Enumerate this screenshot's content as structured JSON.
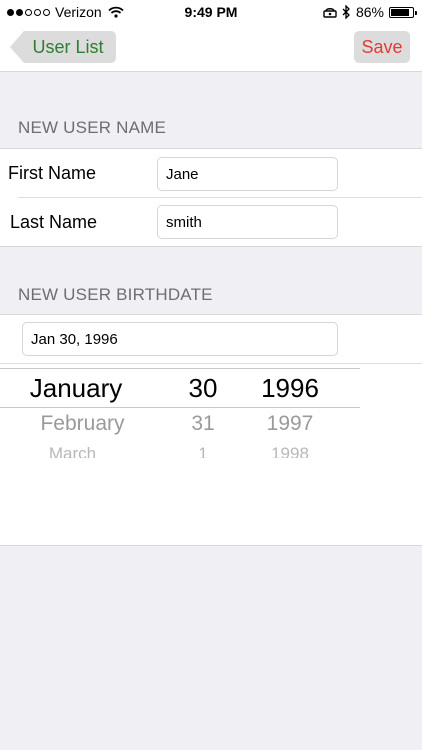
{
  "status_bar": {
    "carrier": "Verizon",
    "time": "9:49 PM",
    "battery_percent_label": "86%",
    "battery_level": 0.86,
    "signal_strength": 2,
    "signal_max": 5,
    "icons": [
      "wifi-icon",
      "alarm-icon",
      "bluetooth-icon",
      "battery-icon"
    ]
  },
  "nav": {
    "back_label": "User List",
    "save_label": "Save",
    "back_color": "#2e7d32",
    "save_color": "#e53935"
  },
  "name_section": {
    "header": "NEW USER NAME",
    "first_label": "First Name",
    "first_value": "Jane",
    "last_label": "Last Name",
    "last_value": "smith"
  },
  "birthdate_section": {
    "header": "NEW USER BIRTHDATE",
    "date_value": "Jan 30, 1996"
  },
  "picker": {
    "months": [
      "January",
      "February",
      "March"
    ],
    "days": [
      "30",
      "31",
      "1"
    ],
    "years": [
      "1996",
      "1997",
      "1998"
    ],
    "selected_index": 0
  }
}
